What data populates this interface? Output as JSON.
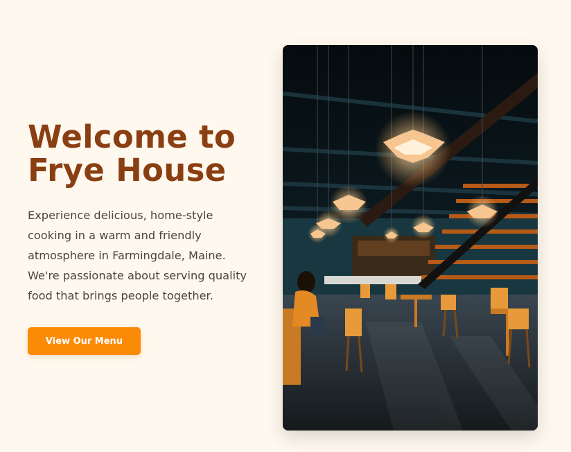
{
  "hero": {
    "title_line1": "Welcome to",
    "title_line2": "Frye House",
    "description": "Experience delicious, home-style cooking in a warm and friendly atmosphere in Farmingdale, Maine. We're passionate about serving quality food that brings people together.",
    "cta_label": "View Our Menu"
  },
  "image": {
    "alt": "Frye House restaurant interior"
  },
  "colors": {
    "background": "#fff8ee",
    "title": "#8a3f12",
    "text": "#4a4540",
    "accent": "#fb8a07"
  }
}
